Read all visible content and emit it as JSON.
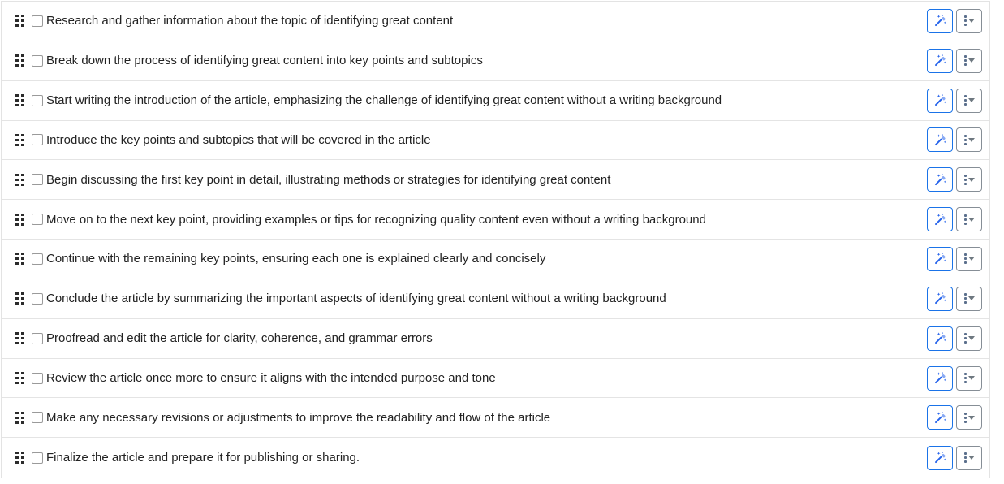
{
  "list": {
    "name": "task-checklist",
    "row_action_labels": {
      "magic_icon": "magic-wand-icon",
      "menu_icon": "vertical-dots-icon",
      "caret_icon": "chevron-down-icon",
      "drag_icon": "drag-handle-icon",
      "checkbox_name": "task-checkbox"
    },
    "colors": {
      "magic_button_border": "#1a73e8",
      "magic_icon": "#2563eb",
      "menu_button_border": "#868e96",
      "menu_dots": "#5b6f8c",
      "caret": "#6e7880",
      "row_divider": "#e4e4e4",
      "text": "#222222",
      "checkbox_border": "#9a9a9a",
      "background": "#ffffff"
    },
    "items": [
      {
        "text": "Research and gather information about the topic of identifying great content",
        "checked": false
      },
      {
        "text": "Break down the process of identifying great content into key points and subtopics",
        "checked": false
      },
      {
        "text": "Start writing the introduction of the article, emphasizing the challenge of identifying great content without a writing background",
        "checked": false
      },
      {
        "text": "Introduce the key points and subtopics that will be covered in the article",
        "checked": false
      },
      {
        "text": "Begin discussing the first key point in detail, illustrating methods or strategies for identifying great content",
        "checked": false
      },
      {
        "text": "Move on to the next key point, providing examples or tips for recognizing quality content even without a writing background",
        "checked": false
      },
      {
        "text": "Continue with the remaining key points, ensuring each one is explained clearly and concisely",
        "checked": false
      },
      {
        "text": "Conclude the article by summarizing the important aspects of identifying great content without a writing background",
        "checked": false
      },
      {
        "text": "Proofread and edit the article for clarity, coherence, and grammar errors",
        "checked": false
      },
      {
        "text": "Review the article once more to ensure it aligns with the intended purpose and tone",
        "checked": false
      },
      {
        "text": "Make any necessary revisions or adjustments to improve the readability and flow of the article",
        "checked": false
      },
      {
        "text": "Finalize the article and prepare it for publishing or sharing.",
        "checked": false
      }
    ]
  }
}
